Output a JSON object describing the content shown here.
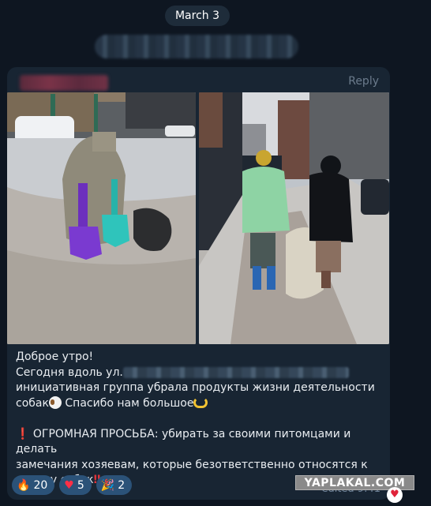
{
  "date_separator": "March 3",
  "message": {
    "reply_label": "Reply",
    "caption": {
      "line1": "Доброе утро!",
      "line2_prefix": "Сегодня вдоль ул.",
      "line3": "инициативная группа убрала продукты жизни деятельности",
      "line4_prefix": "собак",
      "line4_suffix": " Спасибо нам большое",
      "line6_prefix": " ОГРОМНАЯ ПРОСЬБА: убирать за своими питомцами и делать",
      "line7": "замечания хозяевам, которые безответственно относятся к",
      "line8_prefix": "выгулу собак"
    },
    "reactions": [
      {
        "icon": "fire-icon",
        "glyph": "🔥",
        "count": "20"
      },
      {
        "icon": "heart-icon",
        "glyph": "♥",
        "count": "5"
      },
      {
        "icon": "party-popper-icon",
        "glyph": "🎉",
        "count": "2"
      }
    ],
    "edited_label": "edited 9:41"
  },
  "watermark": "YAPLAKAL.COM",
  "colors": {
    "background": "#0e1621",
    "bubble": "#182533",
    "reaction_pill": "#2b5278",
    "accent_red": "#e0333a"
  }
}
